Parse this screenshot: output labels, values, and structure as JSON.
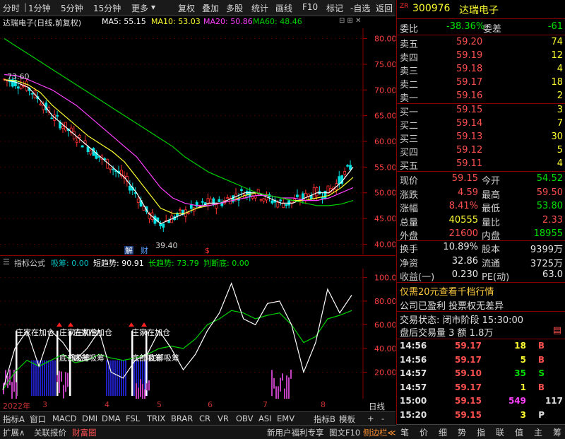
{
  "toolbar": {
    "items": [
      "分时",
      "1分钟",
      "5分钟",
      "15分钟",
      "更多",
      "复权",
      "叠加",
      "多股",
      "统计",
      "画线",
      "F10",
      "标记",
      "-自选",
      "返回"
    ]
  },
  "chart_title": {
    "stock": "达瑞电子(日线,前复权)",
    "ma5": "MA5: 55.15",
    "ma10": "MA10: 53.03",
    "ma20": "MA20: 50.86",
    "ma60": "MA60: 48.46"
  },
  "main_axis": [
    "80.00",
    "75.00",
    "70.00",
    "65.00",
    "60.00",
    "55.00",
    "50.00",
    "45.00",
    "40.00"
  ],
  "annotations": {
    "high": "73.60",
    "low": "39.40",
    "jie": "解",
    "cai": "财",
    "dollar": "$"
  },
  "indicator_title": {
    "name": "指标公式",
    "xichou": "吸筹: 0.00",
    "short": "短趋势: 90.91",
    "long": "长趋势: 73.79",
    "panduan": "判断底: 0.00"
  },
  "ind_axis": [
    "100.0",
    "80.00",
    "60.00",
    "40.00",
    "20.00"
  ],
  "ind_labels": {
    "l1": "庄家在加仓",
    "l2": "庄家在加仓",
    "l3": "庄家在加仓",
    "l4": "庄家在加仓",
    "l5": "底部吸筹",
    "l6": "底部吸筹",
    "l7": "底部吸筹",
    "l8": "底部吸筹"
  },
  "dates": {
    "year": "2022年",
    "m3": "3",
    "m4": "4",
    "m5": "5",
    "m6": "6",
    "m7": "7",
    "m8": "8"
  },
  "tabs": [
    "指标A",
    "窗口",
    "MACD",
    "DMI",
    "DMA",
    "FSL",
    "TRIX",
    "BRAR",
    "CR",
    "VR",
    "OBV",
    "ASI",
    "EMV",
    "指标B",
    "模板",
    "+",
    "-",
    "日线"
  ],
  "bottom": {
    "expand": "扩展∧",
    "link_quote": "关联报价",
    "fortune": "财富圈",
    "promo": "新用户福利专享",
    "f10": "图文F10",
    "sidebar": "侧边栏≪"
  },
  "right_tabs": [
    "笔",
    "价",
    "细",
    "势",
    "指",
    "联",
    "值",
    "主",
    "筹"
  ],
  "stock": {
    "code": "300976",
    "name": "达瑞电子",
    "zr": "ZR"
  },
  "weibi": {
    "label1": "委比",
    "value1": "-38.36%",
    "label2": "委差",
    "value2": "-61"
  },
  "asks": [
    {
      "label": "卖五",
      "price": "59.20",
      "vol": "74"
    },
    {
      "label": "卖四",
      "price": "59.19",
      "vol": "12"
    },
    {
      "label": "卖三",
      "price": "59.18",
      "vol": "4"
    },
    {
      "label": "卖二",
      "price": "59.17",
      "vol": "18"
    },
    {
      "label": "卖一",
      "price": "59.16",
      "vol": "2"
    }
  ],
  "bids": [
    {
      "label": "买一",
      "price": "59.15",
      "vol": "3"
    },
    {
      "label": "买二",
      "price": "59.14",
      "vol": "7"
    },
    {
      "label": "买三",
      "price": "59.13",
      "vol": "30"
    },
    {
      "label": "买四",
      "price": "59.12",
      "vol": "5"
    },
    {
      "label": "买五",
      "price": "59.11",
      "vol": "4"
    }
  ],
  "quote": [
    {
      "l1": "现价",
      "v1": "59.15",
      "l2": "今开",
      "v2": "54.52"
    },
    {
      "l1": "涨跌",
      "v1": "4.59",
      "l2": "最高",
      "v2": "59.50"
    },
    {
      "l1": "涨幅",
      "v1": "8.41%",
      "l2": "最低",
      "v2": "53.80"
    },
    {
      "l1": "总量",
      "v1": "40555",
      "l2": "量比",
      "v2": "2.33"
    },
    {
      "l1": "外盘",
      "v1": "21600",
      "l2": "内盘",
      "v2": "18955"
    }
  ],
  "info": [
    {
      "l1": "换手",
      "v1": "10.89%",
      "l2": "股本",
      "v2": "9399万"
    },
    {
      "l1": "净资",
      "v1": "32.86",
      "l2": "流通",
      "v2": "3725万"
    },
    {
      "l1": "收益(一)",
      "v1": "0.230",
      "l2": "PE(动)",
      "v2": "63.0"
    }
  ],
  "promo_link": "仅需20元查看千档行情",
  "company_note": "公司已盈利 投票权无差异",
  "trade_status": "交易状态: 闭市阶段 15:30:00",
  "after_hours": "盘后交易量 3 额 1.8万",
  "ticks": [
    {
      "time": "14:56",
      "price": "59.17",
      "vol": "18",
      "side": "B"
    },
    {
      "time": "14:56",
      "price": "59.17",
      "vol": "5",
      "side": "B"
    },
    {
      "time": "14:57",
      "price": "59.10",
      "vol": "35",
      "side": "S"
    },
    {
      "time": "14:57",
      "price": "59.17",
      "vol": "1",
      "side": "B"
    },
    {
      "time": "15:00",
      "price": "59.15",
      "vol": "549",
      "side": "117"
    },
    {
      "time": "15:20",
      "price": "59.15",
      "vol": "3",
      "side": "P"
    }
  ],
  "colors": {
    "up": "#ff5050",
    "down": "#00e000",
    "ma5": "#ffffff",
    "ma10": "#ffff30",
    "ma20": "#ff40ff",
    "ma60": "#00d000",
    "grid": "#800000"
  },
  "chart_data": {
    "type": "line",
    "ylim": [
      38,
      82
    ],
    "series": [
      {
        "name": "MA5",
        "values": [
          72,
          71.5,
          70.5,
          68,
          65,
          63,
          61,
          59,
          57,
          55,
          53,
          50,
          46,
          44,
          45,
          46,
          47,
          48,
          48,
          49,
          50,
          50,
          49,
          48,
          48,
          49,
          50,
          50,
          52,
          55
        ]
      },
      {
        "name": "MA10",
        "values": [
          72,
          71.8,
          71,
          69.5,
          67,
          65,
          63,
          61,
          59.5,
          58,
          56,
          53,
          50,
          47,
          46,
          46,
          47,
          47.5,
          48,
          48.5,
          49.5,
          50,
          49.5,
          49,
          48.5,
          48.5,
          49,
          49.5,
          51,
          53
        ]
      },
      {
        "name": "MA20",
        "values": [
          73,
          72.8,
          72,
          71,
          70,
          68.5,
          67,
          65,
          63,
          61,
          59,
          57,
          54,
          51,
          49,
          48,
          47.5,
          47.5,
          48,
          48.5,
          49,
          49.5,
          49.5,
          49,
          49,
          48.5,
          48.5,
          49,
          50,
          51
        ]
      },
      {
        "name": "MA60",
        "values": [
          80,
          78.5,
          77,
          75.5,
          74,
          72.5,
          71,
          69.5,
          68,
          66.5,
          65,
          63.5,
          62,
          60.5,
          59,
          57,
          55.5,
          54,
          53,
          52,
          51,
          50,
          49.5,
          49,
          48.5,
          48,
          47.5,
          47.5,
          47.8,
          48.5
        ]
      }
    ]
  }
}
